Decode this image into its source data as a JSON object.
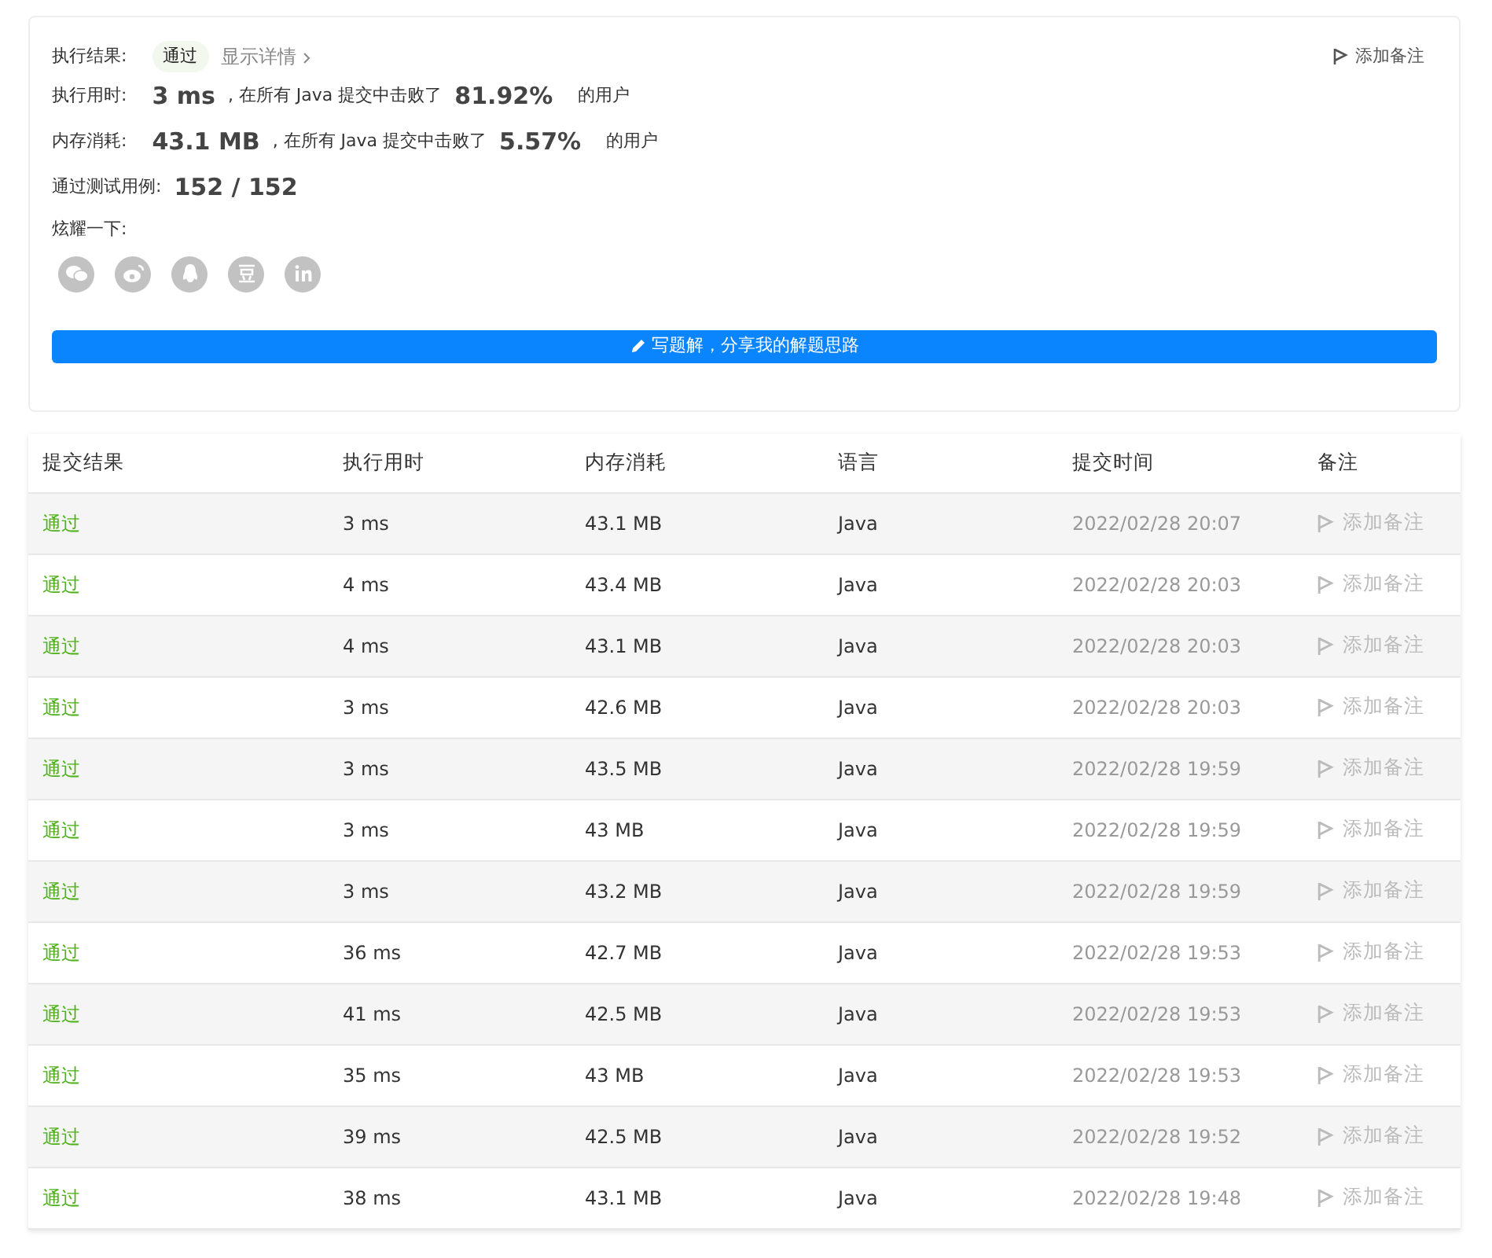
{
  "result": {
    "label": "执行结果:",
    "status": "通过",
    "details_link": "显示详情",
    "note_button": "添加备注"
  },
  "stats": [
    {
      "label": "执行用时:",
      "value": "3 ms",
      "middle": ", 在所有 Java 提交中击败了",
      "percent": "81.92%",
      "suffix": "的用户"
    },
    {
      "label": "内存消耗:",
      "value": "43.1 MB",
      "middle": ", 在所有 Java 提交中击败了",
      "percent": "5.57%",
      "suffix": "的用户"
    }
  ],
  "tests": {
    "label": "通过测试用例:",
    "value": "152 / 152"
  },
  "share": {
    "label": "炫耀一下:"
  },
  "write_button": "写题解，分享我的解题思路",
  "table": {
    "columns": [
      "提交结果",
      "执行用时",
      "内存消耗",
      "语言",
      "提交时间",
      "备注"
    ],
    "rows": [
      {
        "result": "通过",
        "time": "3 ms",
        "memory": "43.1 MB",
        "language": "Java",
        "submitted": "2022/02/28 20:07",
        "note": "添加备注"
      },
      {
        "result": "通过",
        "time": "4 ms",
        "memory": "43.4 MB",
        "language": "Java",
        "submitted": "2022/02/28 20:03",
        "note": "添加备注"
      },
      {
        "result": "通过",
        "time": "4 ms",
        "memory": "43.1 MB",
        "language": "Java",
        "submitted": "2022/02/28 20:03",
        "note": "添加备注"
      },
      {
        "result": "通过",
        "time": "3 ms",
        "memory": "42.6 MB",
        "language": "Java",
        "submitted": "2022/02/28 20:03",
        "note": "添加备注"
      },
      {
        "result": "通过",
        "time": "3 ms",
        "memory": "43.5 MB",
        "language": "Java",
        "submitted": "2022/02/28 19:59",
        "note": "添加备注"
      },
      {
        "result": "通过",
        "time": "3 ms",
        "memory": "43 MB",
        "language": "Java",
        "submitted": "2022/02/28 19:59",
        "note": "添加备注"
      },
      {
        "result": "通过",
        "time": "3 ms",
        "memory": "43.2 MB",
        "language": "Java",
        "submitted": "2022/02/28 19:59",
        "note": "添加备注"
      },
      {
        "result": "通过",
        "time": "36 ms",
        "memory": "42.7 MB",
        "language": "Java",
        "submitted": "2022/02/28 19:53",
        "note": "添加备注"
      },
      {
        "result": "通过",
        "time": "41 ms",
        "memory": "42.5 MB",
        "language": "Java",
        "submitted": "2022/02/28 19:53",
        "note": "添加备注"
      },
      {
        "result": "通过",
        "time": "35 ms",
        "memory": "43 MB",
        "language": "Java",
        "submitted": "2022/02/28 19:53",
        "note": "添加备注"
      },
      {
        "result": "通过",
        "time": "39 ms",
        "memory": "42.5 MB",
        "language": "Java",
        "submitted": "2022/02/28 19:52",
        "note": "添加备注"
      },
      {
        "result": "通过",
        "time": "38 ms",
        "memory": "43.1 MB",
        "language": "Java",
        "submitted": "2022/02/28 19:48",
        "note": "添加备注"
      }
    ]
  }
}
